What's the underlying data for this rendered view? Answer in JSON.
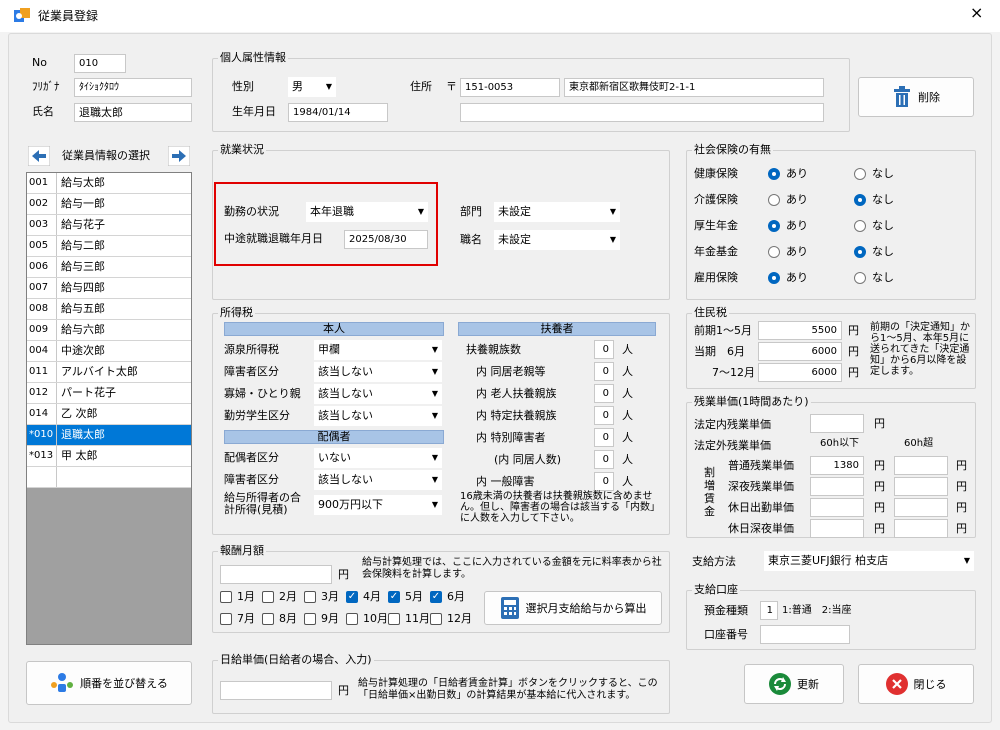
{
  "window": {
    "title": "従業員登録",
    "close": "×"
  },
  "employee": {
    "no_label": "No",
    "no_value": "010",
    "kana_label": "ﾌﾘｶﾞﾅ",
    "kana_value": "ﾀｲｼｮｸﾀﾛｳ",
    "name_label": "氏名",
    "name_value": "退職太郎"
  },
  "selector": {
    "title": "従業員情報の選択"
  },
  "employees": [
    {
      "code": "001",
      "name": "給与太郎"
    },
    {
      "code": "002",
      "name": "給与一郎"
    },
    {
      "code": "003",
      "name": "給与花子"
    },
    {
      "code": "005",
      "name": "給与二郎"
    },
    {
      "code": "006",
      "name": "給与三郎"
    },
    {
      "code": "007",
      "name": "給与四郎"
    },
    {
      "code": "008",
      "name": "給与五郎"
    },
    {
      "code": "009",
      "name": "給与六郎"
    },
    {
      "code": "004",
      "name": "中途次郎"
    },
    {
      "code": "011",
      "name": "アルバイト太郎"
    },
    {
      "code": "012",
      "name": "パート花子"
    },
    {
      "code": "014",
      "name": "乙 次郎"
    },
    {
      "code": "*010",
      "name": "退職太郎",
      "selected": true
    },
    {
      "code": "*013",
      "name": "甲 太郎"
    }
  ],
  "sort_button": "順番を並び替える",
  "personal": {
    "title": "個人属性情報",
    "gender_label": "性別",
    "gender_value": "男",
    "birth_label": "生年月日",
    "birth_value": "1984/01/14",
    "address_label": "住所",
    "postal_mark": "〒",
    "postal_value": "151-0053",
    "address_value": "東京都新宿区歌舞伎町2-1-1",
    "address2_value": ""
  },
  "delete_button": "削除",
  "employment": {
    "title": "就業状況",
    "status_label": "勤務の状況",
    "status_value": "本年退職",
    "retire_label": "中途就職退職年月日",
    "retire_value": "2025/08/30",
    "dept_label": "部門",
    "dept_value": "未設定",
    "position_label": "職名",
    "position_value": "未設定"
  },
  "income_tax": {
    "title": "所得税",
    "self_header": "本人",
    "tax_class_label": "源泉所得税",
    "tax_class_value": "甲欄",
    "disability_label": "障害者区分",
    "disability_value": "該当しない",
    "widow_label": "寡婦・ひとり親",
    "widow_value": "該当しない",
    "student_label": "勤労学生区分",
    "student_value": "該当しない",
    "spouse_header": "配偶者",
    "spouse_label": "配偶者区分",
    "spouse_value": "いない",
    "spouse_dis_label": "障害者区分",
    "spouse_dis_value": "該当しない",
    "income_label1": "給与所得者の合",
    "income_label2": "計所得(見積)",
    "income_value": "900万円以下",
    "dependents_header": "扶養者",
    "dependents": [
      {
        "label": "扶養親族数",
        "value": "0",
        "unit": "人"
      },
      {
        "label": "内 同居老親等",
        "value": "0",
        "unit": "人"
      },
      {
        "label": "内 老人扶養親族",
        "value": "0",
        "unit": "人"
      },
      {
        "label": "内 特定扶養親族",
        "value": "0",
        "unit": "人"
      },
      {
        "label": "内 特別障害者",
        "value": "0",
        "unit": "人"
      },
      {
        "label": "(内 同居人数)",
        "value": "0",
        "unit": "人"
      },
      {
        "label": "内 一般障害",
        "value": "0",
        "unit": "人"
      }
    ],
    "note": "16歳未満の扶養者は扶養親族数に含めません。但し、障害者の場合は該当する「内数」に人数を入力して下さい。"
  },
  "remuneration": {
    "title": "報酬月額",
    "value": "",
    "unit": "円",
    "note": "給与計算処理では、ここに入力されている金額を元に料率表から社会保険料を計算します。",
    "months": [
      {
        "label": "1月",
        "checked": false
      },
      {
        "label": "2月",
        "checked": false
      },
      {
        "label": "3月",
        "checked": false
      },
      {
        "label": "4月",
        "checked": true
      },
      {
        "label": "5月",
        "checked": true
      },
      {
        "label": "6月",
        "checked": true
      },
      {
        "label": "7月",
        "checked": false
      },
      {
        "label": "8月",
        "checked": false
      },
      {
        "label": "9月",
        "checked": false
      },
      {
        "label": "10月",
        "checked": false
      },
      {
        "label": "11月",
        "checked": false
      },
      {
        "label": "12月",
        "checked": false
      }
    ],
    "calc_button": "選択月支給給与から算出"
  },
  "daily": {
    "title": "日給単価(日給者の場合、入力)",
    "value": "",
    "unit": "円",
    "note": "給与計算処理の「日給者賃金計算」ボタンをクリックすると、この「日給単価×出勤日数」の計算結果が基本給に代入されます。"
  },
  "social": {
    "title": "社会保険の有無",
    "on_label": "あり",
    "off_label": "なし",
    "items": [
      {
        "label": "健康保険",
        "value": "on"
      },
      {
        "label": "介護保険",
        "value": "off"
      },
      {
        "label": "厚生年金",
        "value": "on"
      },
      {
        "label": "年金基金",
        "value": "off"
      },
      {
        "label": "雇用保険",
        "value": "on"
      }
    ]
  },
  "resident": {
    "title": "住民税",
    "rows": [
      {
        "label": "前期1～5月",
        "value": "5500",
        "unit": "円"
      },
      {
        "label": "当期　6月",
        "value": "6000",
        "unit": "円"
      },
      {
        "label": "7～12月",
        "value": "6000",
        "unit": "円"
      }
    ],
    "note": "前期の「決定通知」から1～5月、本年5月に送られてきた「決定通知」から6月以降を設定します。"
  },
  "overtime": {
    "title": "残業単価(1時間あたり)",
    "legal_in_label": "法定内残業単価",
    "legal_in_value": "",
    "unit": "円",
    "legal_out_label": "法定外残業単価",
    "col1": "60h以下",
    "col2": "60h超",
    "side_label": "割増賃金",
    "rows": [
      {
        "label": "普通残業単価",
        "v1": "1380",
        "v2": ""
      },
      {
        "label": "深夜残業単価",
        "v1": "",
        "v2": ""
      },
      {
        "label": "休日出勤単価",
        "v1": "",
        "v2": ""
      },
      {
        "label": "休日深夜単価",
        "v1": "",
        "v2": ""
      }
    ]
  },
  "payment": {
    "method_label": "支給方法",
    "method_value": "東京三菱UFJ銀行 柏支店",
    "account_title": "支給口座",
    "type_label": "預金種類",
    "type_value": "1",
    "type_hint": "1:普通　2:当座",
    "number_label": "口座番号",
    "number_value": ""
  },
  "update_button": "更新",
  "close_button": "閉じる",
  "colors": {
    "accent": "#0067c0",
    "highlight": "#e00000",
    "header_bar": "#a8c4e6"
  }
}
